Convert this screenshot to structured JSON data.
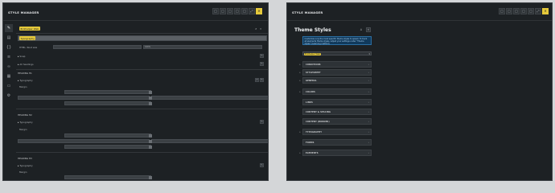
{
  "left": {
    "title": "STYLE MANAGER",
    "tools": [
      "□",
      "□",
      "□",
      "□",
      "□",
      "⤢",
      "✕"
    ],
    "rail_icons": [
      "brush-icon",
      "copy-icon",
      "braces-icon",
      "layers-icon",
      "link-icon",
      "layout-icon",
      "page-icon",
      "gear-icon"
    ],
    "top_tag": "Brizhelper Web",
    "search_tag": "Typography",
    "html_root": "HTML: Root size",
    "root_value": "100%",
    "row_snap": "Snap",
    "row_all_headings": "All headings",
    "h1": {
      "heading": "HEADING H1",
      "typography": "Typography",
      "margin": "Margin"
    },
    "h2": {
      "heading": "HEADING H2",
      "typography": "Typography",
      "margin": "Margin"
    },
    "h3": {
      "heading": "HEADING H3",
      "typography": "Typography",
      "margin": "Margin"
    }
  },
  "right": {
    "title": "STYLE MANAGER",
    "tools": [
      "□",
      "□",
      "□",
      "□",
      "□",
      "⤢",
      "✕"
    ],
    "heading": "Theme Styles",
    "note": "Customize only the most specific theme styles to speed. To track all elements theme styles, adjust your settings under \"Theme styles\" (Learning method)",
    "selected_tag": "Brizhelper Web",
    "sections": [
      "CONDITIONS",
      "STYLESHEET",
      "GENERAL",
      "COLORS",
      "LINKS",
      "CONTENT & SPACING",
      "CONTENT (BORDER)",
      "TYPOGRAPHY",
      "FORMS",
      "ELEMENTS"
    ]
  }
}
